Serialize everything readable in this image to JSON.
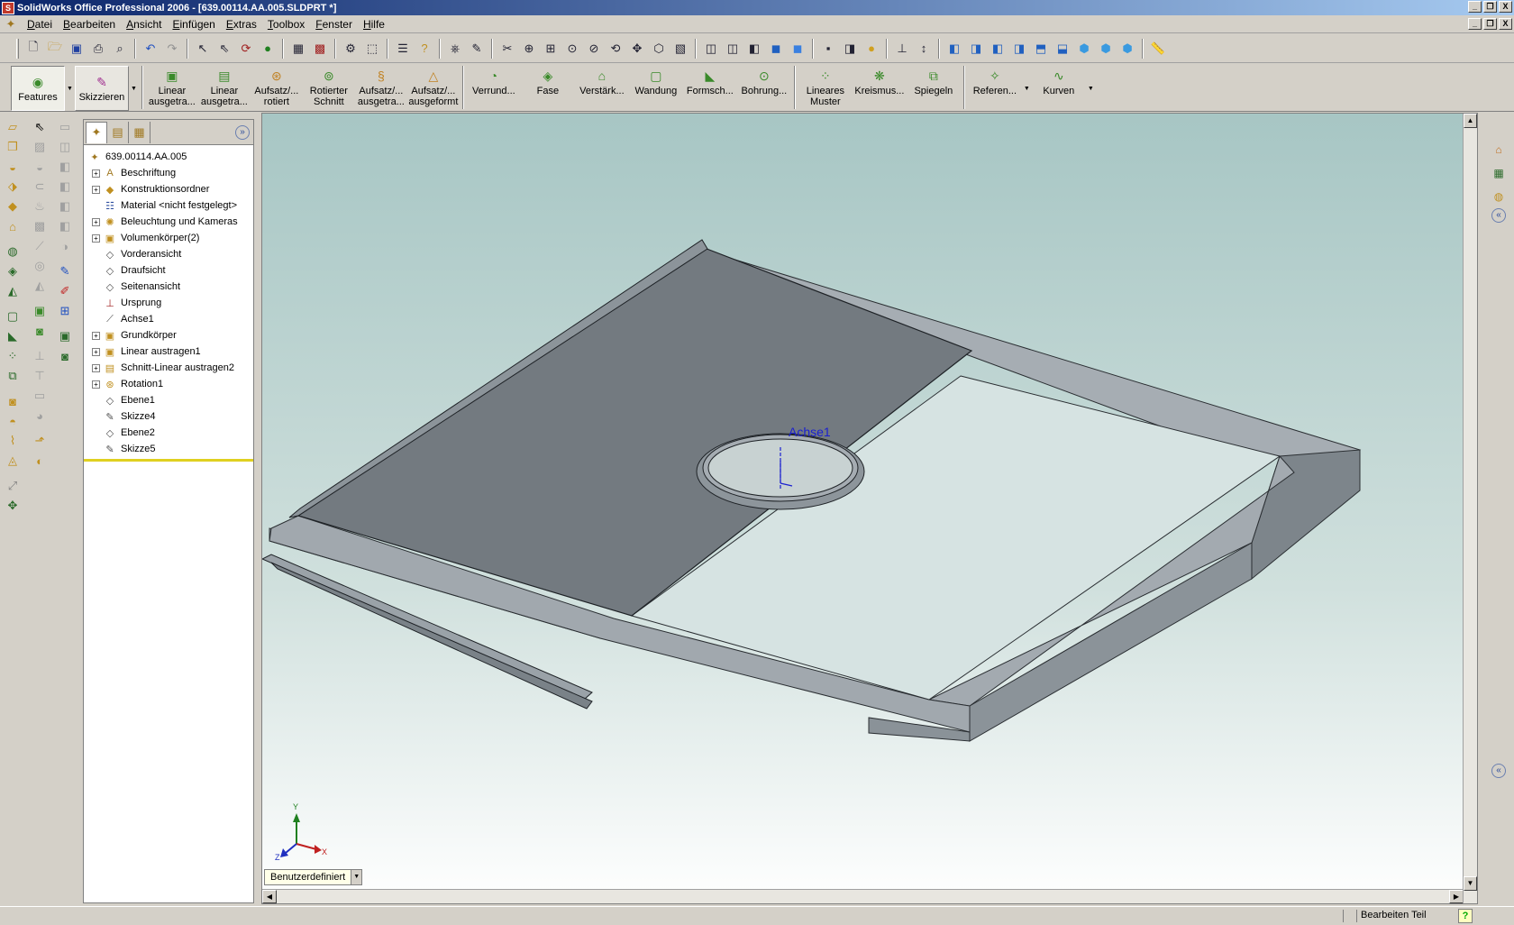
{
  "window": {
    "title": "SolidWorks Office Professional 2006 - [639.00114.AA.005.SLDPRT *]",
    "app_icon": "solidworks-logo-icon",
    "controls": [
      "_",
      "❐",
      "X"
    ]
  },
  "menu": {
    "items": [
      "Datei",
      "Bearbeiten",
      "Ansicht",
      "Einfügen",
      "Extras",
      "Toolbox",
      "Fenster",
      "Hilfe"
    ]
  },
  "command_manager": {
    "tabs": [
      {
        "label": "Features",
        "icon": "features-icon"
      },
      {
        "label": "Skizzieren",
        "icon": "sketch-icon"
      }
    ],
    "buttons": [
      {
        "label": "Linear\nausgetra...",
        "icon": "extruded-boss-icon",
        "color": "#3a8a2a"
      },
      {
        "label": "Linear\nausgetra...",
        "icon": "extruded-cut-icon",
        "color": "#3a8a2a"
      },
      {
        "label": "Aufsatz/...\nrotiert",
        "icon": "revolved-boss-icon",
        "color": "#c08020"
      },
      {
        "label": "Rotierter\nSchnitt",
        "icon": "revolved-cut-icon",
        "color": "#3a8a2a"
      },
      {
        "label": "Aufsatz/...\nausgetra...",
        "icon": "swept-boss-icon",
        "color": "#c08020"
      },
      {
        "label": "Aufsatz/...\nausgeformt",
        "icon": "lofted-boss-icon",
        "color": "#c08020"
      },
      {
        "label": "Verrund...",
        "icon": "fillet-icon",
        "color": "#c08020"
      },
      {
        "label": "Fase",
        "icon": "chamfer-icon",
        "color": "#3a8a2a"
      },
      {
        "label": "Verstärk...",
        "icon": "rib-icon",
        "color": "#3a8a2a"
      },
      {
        "label": "Wandung",
        "icon": "shell-icon",
        "color": "#3a8a2a"
      },
      {
        "label": "Formsch...",
        "icon": "draft-icon",
        "color": "#3a8a2a"
      },
      {
        "label": "Bohrung...",
        "icon": "hole-wizard-icon",
        "color": "#3a8a2a"
      },
      {
        "label": "Lineares\nMuster",
        "icon": "linear-pattern-icon",
        "color": "#3a8a2a"
      },
      {
        "label": "Kreismus...",
        "icon": "circular-pattern-icon",
        "color": "#3a8a2a"
      },
      {
        "label": "Spiegeln",
        "icon": "mirror-icon",
        "color": "#3a8a2a"
      },
      {
        "label": "Referen...",
        "icon": "reference-geometry-icon",
        "color": "#3a8a2a"
      },
      {
        "label": "Kurven",
        "icon": "curves-icon",
        "color": "#3a8a2a"
      }
    ]
  },
  "feature_tree": {
    "root": "639.00114.AA.005",
    "items": [
      {
        "label": "Beschriftung",
        "expandable": true,
        "icon": "annotations-icon"
      },
      {
        "label": "Konstruktionsordner",
        "expandable": true,
        "icon": "design-binder-icon"
      },
      {
        "label": "Material <nicht festgelegt>",
        "expandable": false,
        "icon": "material-icon"
      },
      {
        "label": "Beleuchtung und Kameras",
        "expandable": true,
        "icon": "lights-cameras-icon"
      },
      {
        "label": "Volumenkörper(2)",
        "expandable": true,
        "icon": "solid-bodies-icon"
      },
      {
        "label": "Vorderansicht",
        "expandable": false,
        "icon": "plane-icon"
      },
      {
        "label": "Draufsicht",
        "expandable": false,
        "icon": "plane-icon"
      },
      {
        "label": "Seitenansicht",
        "expandable": false,
        "icon": "plane-icon"
      },
      {
        "label": "Ursprung",
        "expandable": false,
        "icon": "origin-icon"
      },
      {
        "label": "Achse1",
        "expandable": false,
        "icon": "axis-icon"
      },
      {
        "label": "Grundkörper",
        "expandable": true,
        "icon": "extrude-feature-icon"
      },
      {
        "label": "Linear austragen1",
        "expandable": true,
        "icon": "extrude-feature-icon"
      },
      {
        "label": "Schnitt-Linear austragen2",
        "expandable": true,
        "icon": "cut-extrude-feature-icon"
      },
      {
        "label": "Rotation1",
        "expandable": true,
        "icon": "revolve-feature-icon"
      },
      {
        "label": "Ebene1",
        "expandable": false,
        "icon": "plane-icon"
      },
      {
        "label": "Skizze4",
        "expandable": false,
        "icon": "sketch-icon"
      },
      {
        "label": "Ebene2",
        "expandable": false,
        "icon": "plane-icon"
      },
      {
        "label": "Skizze5",
        "expandable": false,
        "icon": "sketch-icon"
      }
    ]
  },
  "viewport": {
    "axis_label": "Achse1",
    "triad": {
      "x": "X",
      "y": "Y",
      "z": "Z"
    },
    "view_orientation": "Benutzerdefiniert"
  },
  "status": {
    "mode": "Bearbeiten Teil",
    "help": "?"
  },
  "colors": {
    "title_start": "#0a246a",
    "title_end": "#a6caf0",
    "model_face_dark": "#747a80",
    "model_face_light": "#a9b0b6",
    "axis_blue": "#1a20d0",
    "rollback_bar": "#e0d020"
  }
}
